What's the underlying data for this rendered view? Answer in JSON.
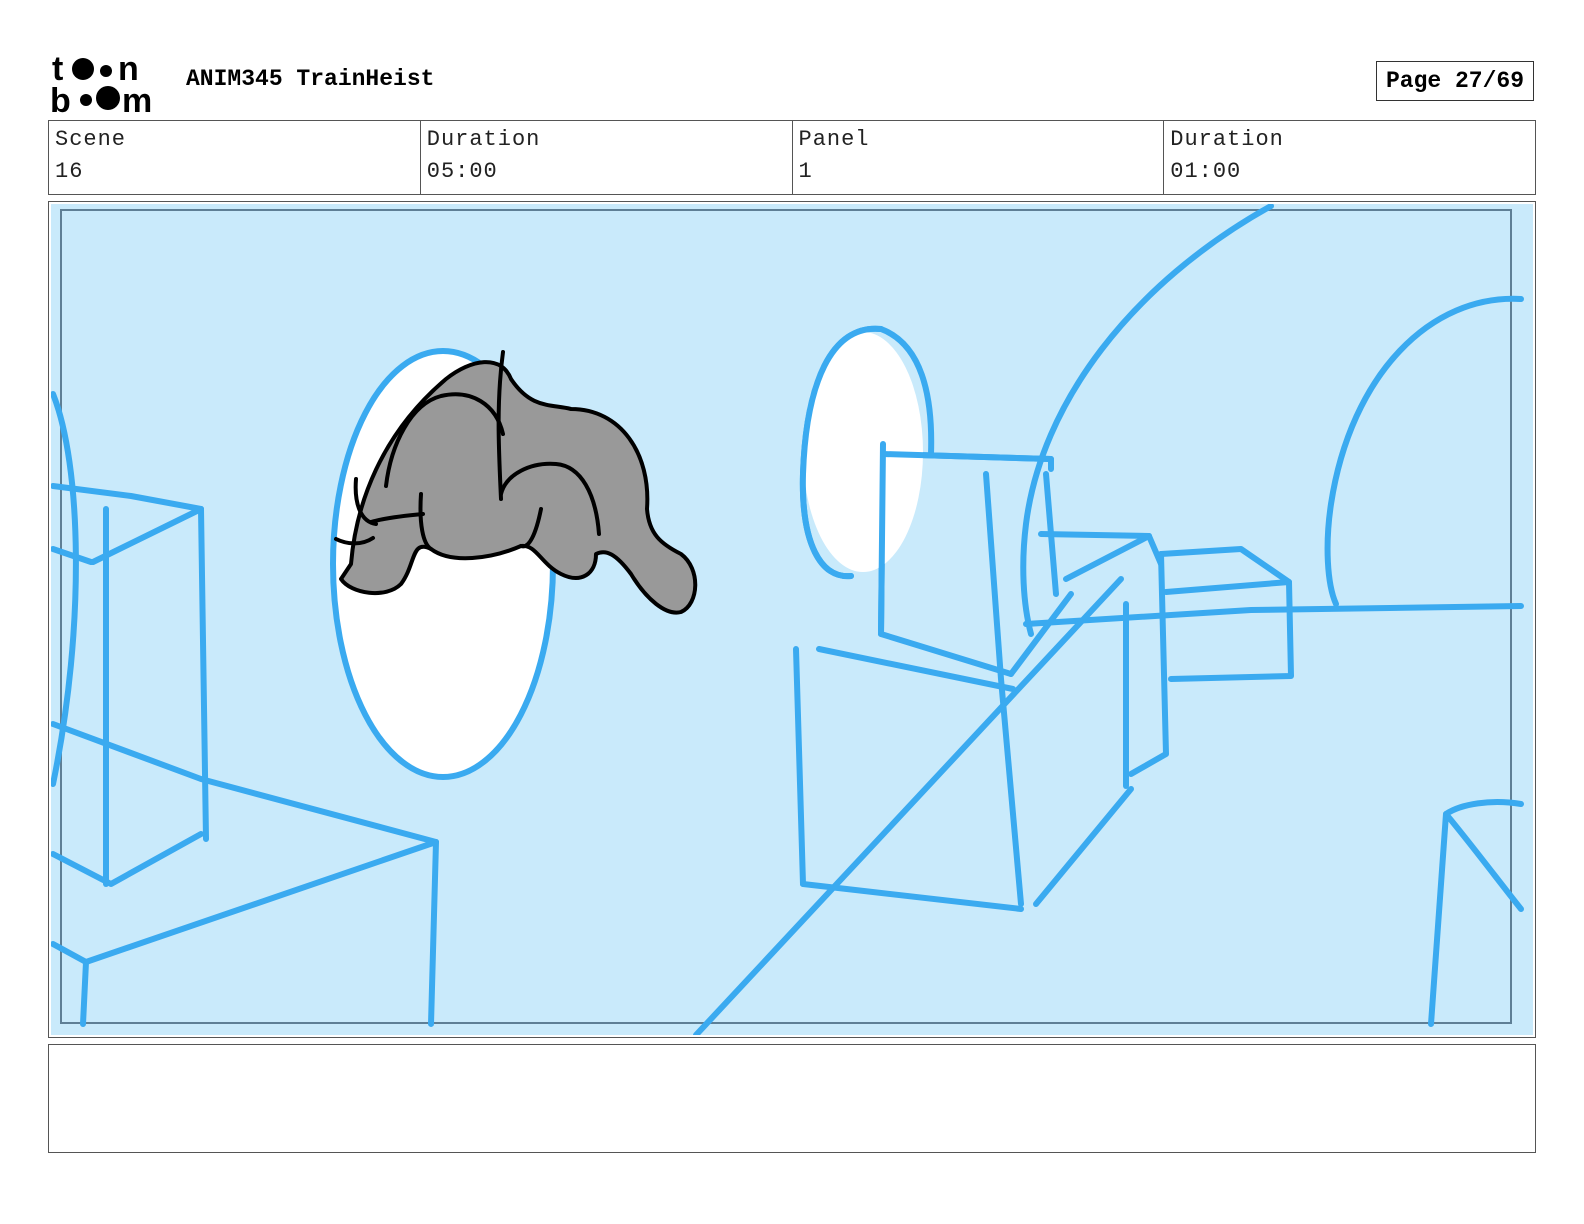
{
  "header": {
    "logo_line1": "toon",
    "logo_line2": "boom",
    "project_title": "ANIM345 TrainHeist",
    "page_label": "Page 27/69"
  },
  "info": {
    "scene_label": "Scene",
    "scene_value": "16",
    "scene_duration_label": "Duration",
    "scene_duration_value": "05:00",
    "panel_label": "Panel",
    "panel_value": "1",
    "panel_duration_label": "Duration",
    "panel_duration_value": "01:00"
  },
  "panel": {
    "background_color": "#c9eafb",
    "line_color": "#3aaaf0",
    "character_fill": "#999999"
  },
  "notes": {
    "text": ""
  }
}
